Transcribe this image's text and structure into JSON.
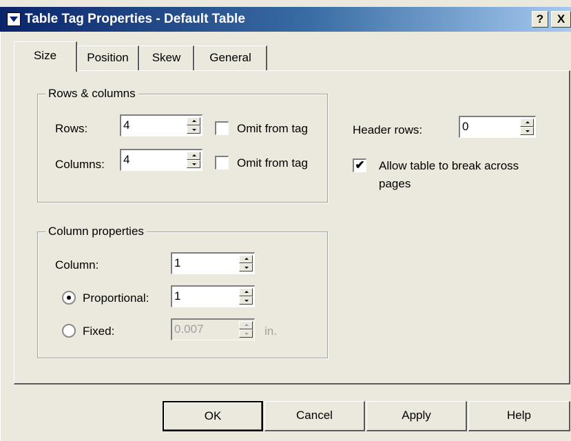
{
  "window": {
    "title": "Table Tag Properties - Default Table",
    "help_glyph": "?",
    "close_glyph": "X"
  },
  "tabs": [
    {
      "label": "Size",
      "active": true
    },
    {
      "label": "Position",
      "active": false
    },
    {
      "label": "Skew",
      "active": false
    },
    {
      "label": "General",
      "active": false
    }
  ],
  "rows_columns": {
    "legend": "Rows & columns",
    "rows_label": "Rows:",
    "rows_value": "4",
    "rows_omit_label": "Omit from tag",
    "rows_omit_checked": false,
    "columns_label": "Columns:",
    "columns_value": "4",
    "columns_omit_label": "Omit from tag",
    "columns_omit_checked": false
  },
  "header": {
    "header_rows_label": "Header rows:",
    "header_rows_value": "0",
    "allow_break_label": "Allow table to break across",
    "allow_break_label_2": "pages",
    "allow_break_checked": true
  },
  "column_properties": {
    "legend": "Column properties",
    "column_label": "Column:",
    "column_value": "1",
    "proportional_label": "Proportional:",
    "proportional_value": "1",
    "proportional_selected": true,
    "fixed_label": "Fixed:",
    "fixed_value": "0.007",
    "fixed_unit": "in.",
    "fixed_selected": false
  },
  "buttons": {
    "ok": "OK",
    "cancel": "Cancel",
    "apply": "Apply",
    "help": "Help"
  },
  "colors": {
    "title_gradient_start": "#0a246a",
    "title_gradient_end": "#a6caf0",
    "face": "#ebe8dd"
  },
  "check_glyph": "✔"
}
